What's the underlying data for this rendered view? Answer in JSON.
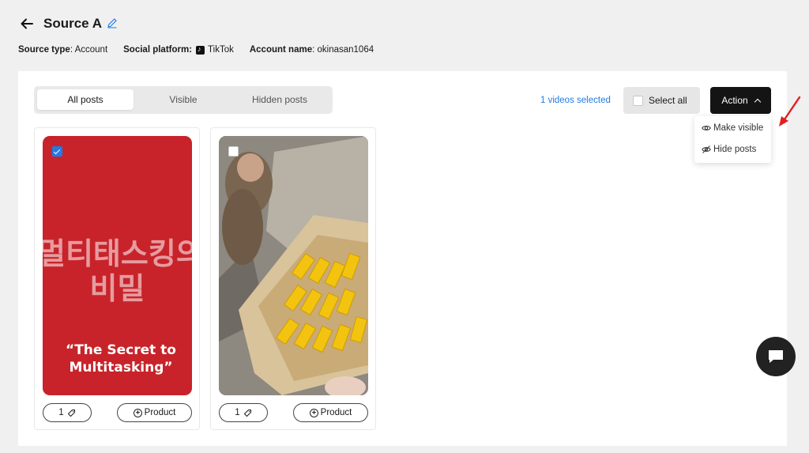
{
  "header": {
    "title": "Source A",
    "source_type_label": "Source type",
    "source_type_value": ": Account",
    "platform_label": "Social platform:",
    "platform_value": "TikTok",
    "account_label": "Account name",
    "account_value": ": okinasan1064"
  },
  "tabs": [
    {
      "label": "All posts",
      "active": true
    },
    {
      "label": "Visible",
      "active": false
    },
    {
      "label": "Hidden posts",
      "active": false
    }
  ],
  "toolbar": {
    "selected_text": "1 videos selected",
    "select_all_label": "Select all",
    "action_label": "Action"
  },
  "action_menu": {
    "items": [
      {
        "label": "Make visible",
        "icon": "eye-icon"
      },
      {
        "label": "Hide posts",
        "icon": "eye-off-icon"
      }
    ]
  },
  "posts": [
    {
      "checked": true,
      "thumb_text_line1": "멀티태스킹의",
      "thumb_text_line2": "비밀",
      "thumb_caption": "“The Secret to Multitasking”",
      "tag_count": "1",
      "product_label": "Product"
    },
    {
      "checked": false,
      "tag_count": "1",
      "product_label": "Product"
    }
  ],
  "colors": {
    "accent": "#1f7be6",
    "action_bg": "#141414",
    "page_bg": "#f0f0f1"
  }
}
